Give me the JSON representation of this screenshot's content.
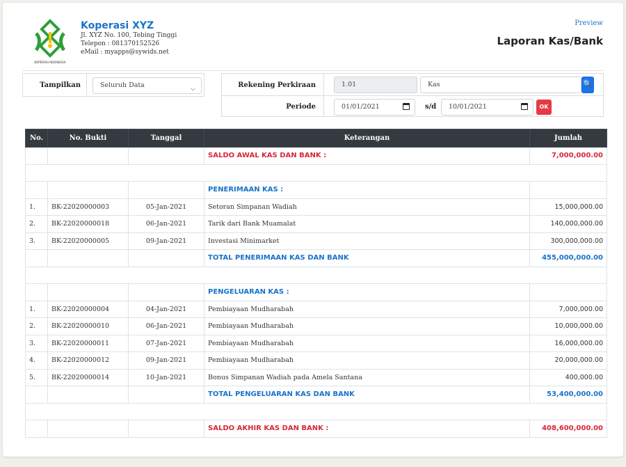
{
  "company": {
    "name": "Koperasi XYZ",
    "address": "Jl. XYZ No. 100, Tebing Tinggi",
    "phone": "Telepon : 081370152526",
    "email": "eMail : myapps@sywids.net",
    "logo_caption": "KOPERASI INDONESIA"
  },
  "header": {
    "preview_link": "Preview",
    "title": "Laporan Kas/Bank"
  },
  "filters": {
    "tampilkan_label": "Tampilkan",
    "tampilkan_value": "Seluruh Data",
    "rekening_label": "Rekening Perkiraan",
    "rekening_code": "1.01",
    "rekening_name": "Kas",
    "periode_label": "Periode",
    "date_from": "01/01/2021",
    "sd_label": "s/d",
    "date_to": "10/01/2021",
    "ok_label": "OK"
  },
  "table": {
    "headers": [
      "No.",
      "No. Bukti",
      "Tanggal",
      "Keterangan",
      "Jumlah"
    ],
    "saldo_awal": {
      "label": "SALDO AWAL KAS DAN BANK :",
      "amount": "7,000,000.00"
    },
    "penerimaan": {
      "title": "PENERIMAAN KAS :",
      "rows": [
        {
          "no": "1.",
          "bukti": "BK-22020000003",
          "tanggal": "05-Jan-2021",
          "ket": "Setoran Simpanan Wadiah",
          "jumlah": "15,000,000.00"
        },
        {
          "no": "2.",
          "bukti": "BK-22020000018",
          "tanggal": "06-Jan-2021",
          "ket": "Tarik dari Bank Muamalat",
          "jumlah": "140,000,000.00"
        },
        {
          "no": "3.",
          "bukti": "BK-22020000005",
          "tanggal": "09-Jan-2021",
          "ket": "Investasi Minimarket",
          "jumlah": "300,000,000.00"
        }
      ],
      "total_label": "TOTAL PENERIMAAN KAS DAN BANK",
      "total_amount": "455,000,000.00"
    },
    "pengeluaran": {
      "title": "PENGELUARAN KAS :",
      "rows": [
        {
          "no": "1.",
          "bukti": "BK-22020000004",
          "tanggal": "04-Jan-2021",
          "ket": "Pembiayaan Mudharabah",
          "jumlah": "7,000,000.00"
        },
        {
          "no": "2.",
          "bukti": "BK-22020000010",
          "tanggal": "06-Jan-2021",
          "ket": "Pembiayaan Mudharabah",
          "jumlah": "10,000,000.00"
        },
        {
          "no": "3.",
          "bukti": "BK-22020000011",
          "tanggal": "07-Jan-2021",
          "ket": "Pembiayaan Mudharabah",
          "jumlah": "16,000,000.00"
        },
        {
          "no": "4.",
          "bukti": "BK-22020000012",
          "tanggal": "09-Jan-2021",
          "ket": "Pembiayaan Mudharabah",
          "jumlah": "20,000,000.00"
        },
        {
          "no": "5.",
          "bukti": "BK-22020000014",
          "tanggal": "10-Jan-2021",
          "ket": "Bonus Simpanan Wadiah pada Amela Santana",
          "jumlah": "400,000.00"
        }
      ],
      "total_label": "TOTAL PENGELUARAN KAS DAN BANK",
      "total_amount": "53,400,000.00"
    },
    "saldo_akhir": {
      "label": "SALDO AKHIR KAS DAN BANK :",
      "amount": "408,600,000.00"
    }
  },
  "colors": {
    "accent_blue": "#1a73c8",
    "accent_red": "#d6283a",
    "header_dark": "#343a40",
    "logo_green": "#2e9e3a"
  }
}
